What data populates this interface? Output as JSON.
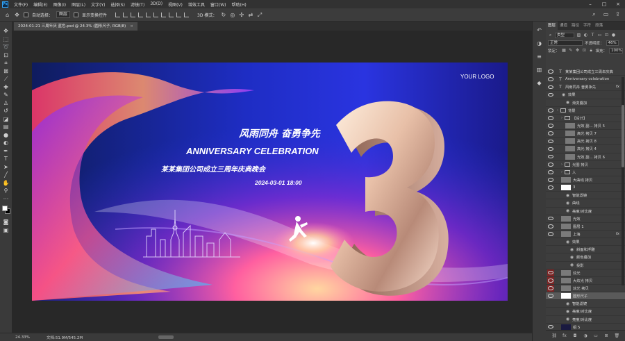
{
  "menubar": {
    "app_icon": "Ps",
    "items": [
      "文件(F)",
      "编辑(E)",
      "图像(I)",
      "图层(L)",
      "文字(Y)",
      "选择(S)",
      "滤镜(T)",
      "3D(D)",
      "视图(V)",
      "增效工具",
      "窗口(W)",
      "帮助(H)"
    ],
    "window_controls": [
      "minimize",
      "maximize",
      "close"
    ]
  },
  "options": {
    "auto_select_label": "自动选择：",
    "auto_select_value": "图层",
    "show_transform_label": "显示变换控件",
    "mode_3d_label": "3D 模式："
  },
  "document": {
    "tab_title": "2024-01-21 三周年庆 蓝色.psd @ 24.3% (圆形尺子, RGB/8)",
    "close_symbol": "×"
  },
  "artwork": {
    "logo": "YOUR LOGO",
    "headline": "风雨同舟  奋勇争先",
    "title_en": "ANNIVERSARY  CELEBRATION",
    "subtitle": "某某集团公司成立三周年庆典晚会",
    "datetime": "2024-03-01  18:00",
    "big_number": "3"
  },
  "status": {
    "zoom": "24.33%",
    "doc_size": "文档:51.9M/545.2M"
  },
  "panel": {
    "tabs": [
      "图层",
      "通道",
      "路径",
      "字符",
      "段落"
    ],
    "filter_kind": "类型",
    "blend_mode": "正常",
    "opacity_label": "不透明度：",
    "opacity_value": "46%",
    "lock_label": "锁定：",
    "fill_label": "填充：",
    "fill_value": "100%"
  },
  "layers": [
    {
      "name": "某某集团公司成立三周年庆典",
      "kind": "text",
      "indent": 0
    },
    {
      "name": "Anniversary celebration",
      "kind": "text",
      "indent": 0
    },
    {
      "name": "风雨同舟  奋勇争先",
      "kind": "text",
      "indent": 0,
      "fx": true
    },
    {
      "name": "效果",
      "kind": "effect",
      "indent": 1
    },
    {
      "name": "渐变叠加",
      "kind": "effect",
      "indent": 2
    },
    {
      "name": "背景",
      "kind": "group",
      "indent": 0
    },
    {
      "name": "【设计】",
      "kind": "group",
      "indent": 1
    },
    {
      "name": "光效  副... 拷贝 5",
      "kind": "pixel",
      "indent": 2
    },
    {
      "name": "高光 拷贝 7",
      "kind": "pixel",
      "indent": 2
    },
    {
      "name": "高光 拷贝 8",
      "kind": "pixel",
      "indent": 2
    },
    {
      "name": "高光 拷贝 4",
      "kind": "pixel",
      "indent": 2
    },
    {
      "name": "光效  副... 拷贝 6",
      "kind": "pixel",
      "indent": 2
    },
    {
      "name": "光圈 拷贝",
      "kind": "group",
      "indent": 1
    },
    {
      "name": "人",
      "kind": "group",
      "indent": 1
    },
    {
      "name": "大曲线 拷贝",
      "kind": "pixel",
      "indent": 1
    },
    {
      "name": "3",
      "kind": "smart",
      "indent": 1
    },
    {
      "name": "智能滤镜",
      "kind": "effect",
      "indent": 2
    },
    {
      "name": "曲线",
      "kind": "effect",
      "indent": 2
    },
    {
      "name": "亮度/对比度",
      "kind": "effect",
      "indent": 2
    },
    {
      "name": "光效",
      "kind": "pixel",
      "indent": 1
    },
    {
      "name": "图层 1",
      "kind": "pixel",
      "indent": 1
    },
    {
      "name": "上海",
      "kind": "pixel",
      "indent": 1,
      "fx": true
    },
    {
      "name": "效果",
      "kind": "effect",
      "indent": 2
    },
    {
      "name": "斜面和浮雕",
      "kind": "effect",
      "indent": 3
    },
    {
      "name": "颜色叠加",
      "kind": "effect",
      "indent": 3
    },
    {
      "name": "投影",
      "kind": "effect",
      "indent": 3
    },
    {
      "name": "炫光",
      "kind": "pixel",
      "indent": 1,
      "red": true
    },
    {
      "name": "大炫光 拷贝",
      "kind": "pixel",
      "indent": 1,
      "red": true
    },
    {
      "name": "炫光 拷贝",
      "kind": "pixel",
      "indent": 1,
      "red": true
    },
    {
      "name": "圆形尺子",
      "kind": "smart",
      "indent": 1,
      "selected": true
    },
    {
      "name": "智能滤镜",
      "kind": "effect",
      "indent": 2
    },
    {
      "name": "亮度/对比度",
      "kind": "effect",
      "indent": 2
    },
    {
      "name": "亮度/对比度",
      "kind": "effect",
      "indent": 2
    },
    {
      "name": "组 5",
      "kind": "pixel",
      "indent": 1,
      "dark": true
    },
    {
      "name": "背景",
      "kind": "pixel",
      "indent": 0,
      "white": true,
      "lock": true
    }
  ],
  "colors": {
    "accent": "#31a8ff",
    "canvas_blue": "#2a34e0",
    "hidden_layer_red": "#7c2525"
  }
}
